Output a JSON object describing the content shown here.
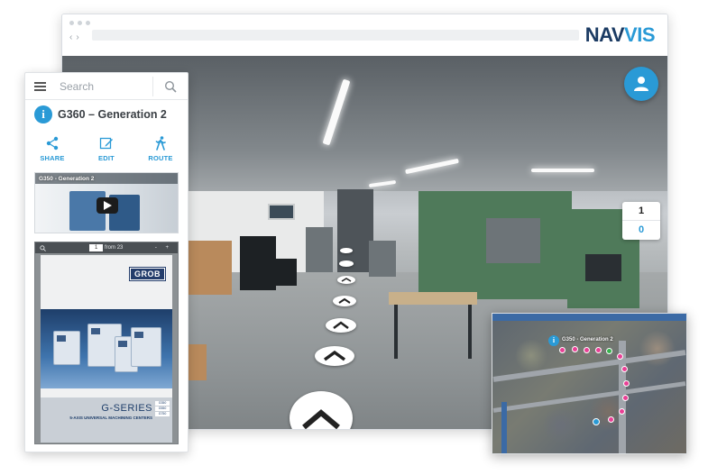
{
  "brand": {
    "logo_primary": "NAV",
    "logo_secondary": "VIS",
    "primary_color": "#1b3b63",
    "accent_color": "#2a9ad6"
  },
  "browser": {
    "nav_back": "‹",
    "nav_forward": "›"
  },
  "viewer": {
    "floor_selector": {
      "upper": "1",
      "lower": "0"
    },
    "user_button_icon": "user-icon"
  },
  "panel": {
    "search": {
      "placeholder": "Search",
      "value": ""
    },
    "menu_icon": "hamburger-icon",
    "poi": {
      "icon": "info-icon",
      "icon_glyph": "i",
      "title": "G360 – Generation 2"
    },
    "actions": [
      {
        "label": "SHARE",
        "icon": "share-icon"
      },
      {
        "label": "EDIT",
        "icon": "edit-icon"
      },
      {
        "label": "ROUTE",
        "icon": "walking-person-icon"
      }
    ],
    "video": {
      "title": "G350 - Generation 2",
      "icon": "play-icon"
    },
    "document": {
      "page_current": "1",
      "page_separator": "from",
      "page_total": "23",
      "zoom_controls": "- +",
      "brand_badge": "GROB",
      "series_title": "G-SERIES",
      "series_subtitle": "5-AXIS UNIVERSAL MACHINING CENTERS",
      "models": [
        "G350",
        "G550",
        "G750"
      ]
    }
  },
  "minimap": {
    "poi_glyph": "i",
    "poi_label": "G350 - Generation 2",
    "marker_color": "#e93f95"
  }
}
